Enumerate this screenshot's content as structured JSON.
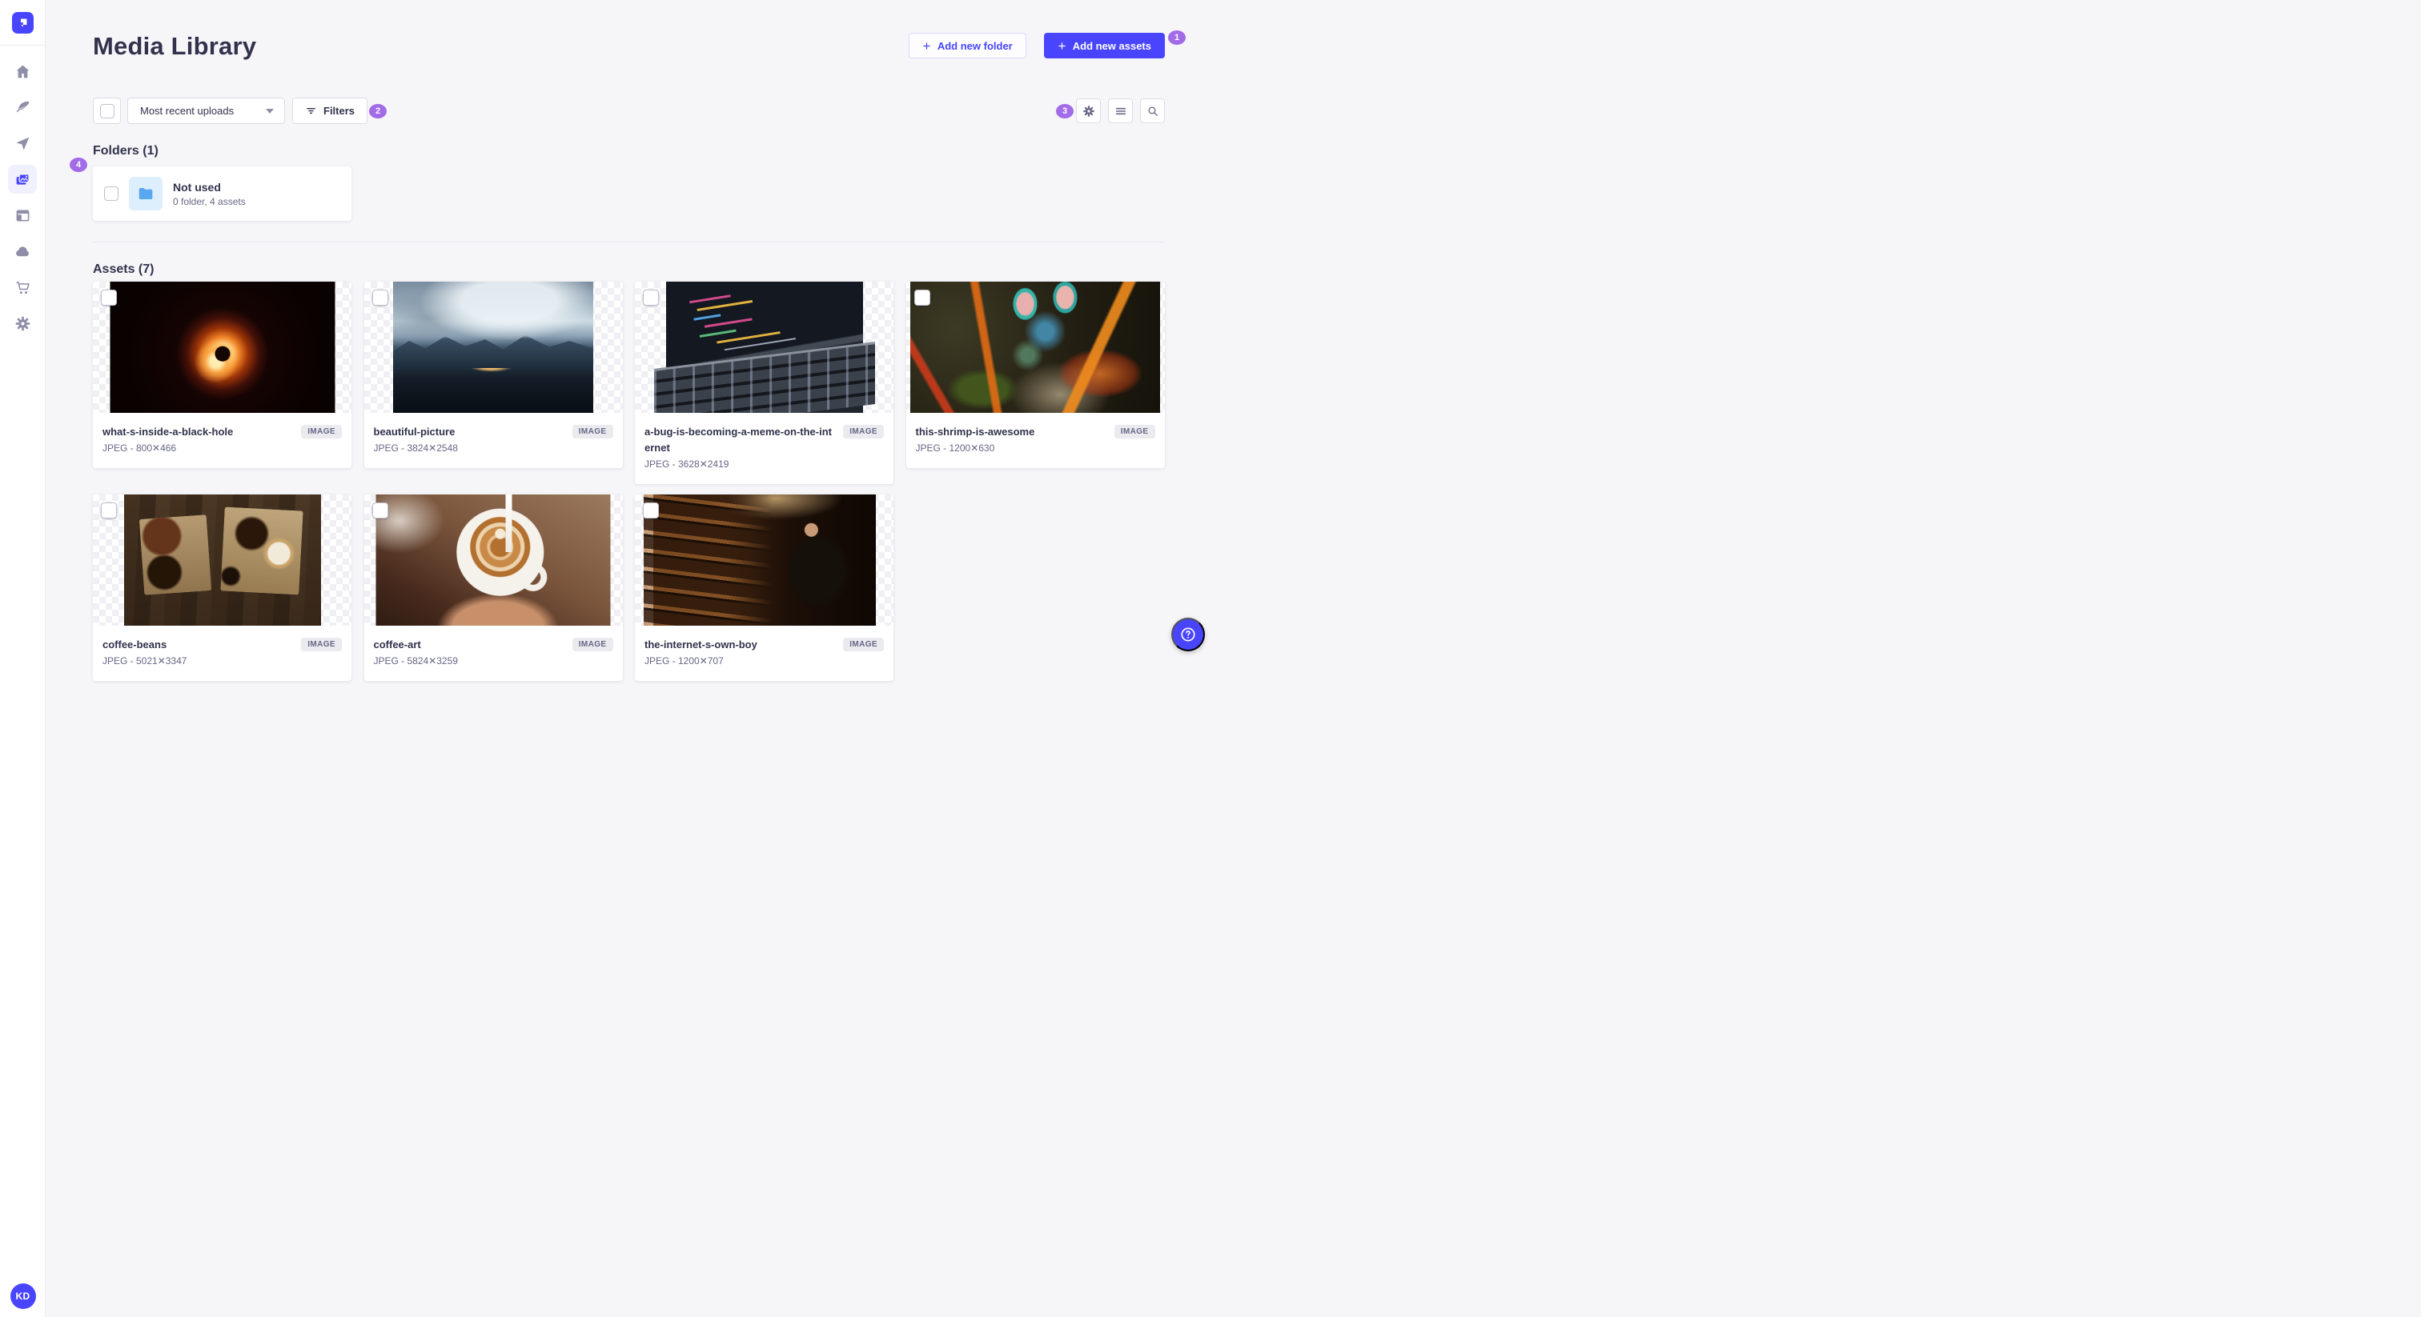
{
  "header": {
    "title": "Media Library",
    "add_folder": "Add new folder",
    "add_assets": "Add new assets"
  },
  "toolbar": {
    "sort_value": "Most recent uploads",
    "filters": "Filters"
  },
  "annotations": {
    "a1": "1",
    "a2": "2",
    "a3": "3",
    "a4": "4"
  },
  "folders": {
    "heading": "Folders (1)",
    "card": {
      "title": "Not used",
      "subtitle": "0 folder, 4 assets"
    }
  },
  "assets": {
    "heading": "Assets (7)",
    "items": [
      {
        "name": "what-s-inside-a-black-hole",
        "meta": "JPEG - 800✕466",
        "badge": "IMAGE",
        "art": "blackhole"
      },
      {
        "name": "beautiful-picture",
        "meta": "JPEG - 3824✕2548",
        "badge": "IMAGE",
        "art": "mountains"
      },
      {
        "name": "a-bug-is-becoming-a-meme-on-the-internet",
        "meta": "JPEG - 3628✕2419",
        "badge": "IMAGE",
        "art": "code"
      },
      {
        "name": "this-shrimp-is-awesome",
        "meta": "JPEG - 1200✕630",
        "badge": "IMAGE",
        "art": "shrimp"
      },
      {
        "name": "coffee-beans",
        "meta": "JPEG - 5021✕3347",
        "badge": "IMAGE",
        "art": "coffeebeans"
      },
      {
        "name": "coffee-art",
        "meta": "JPEG - 5824✕3259",
        "badge": "IMAGE",
        "art": "coffeeart"
      },
      {
        "name": "the-internet-s-own-boy",
        "meta": "JPEG - 1200✕707",
        "badge": "IMAGE",
        "art": "library"
      }
    ]
  },
  "user": {
    "initials": "KD"
  },
  "sidebar": {
    "icons": [
      "home",
      "feather",
      "send",
      "media-library",
      "layout",
      "cloud",
      "cart",
      "gear"
    ]
  },
  "colors": {
    "brand": "#4945FF",
    "marker": "#A26BE8",
    "folder_icon": "#57A8EE"
  }
}
